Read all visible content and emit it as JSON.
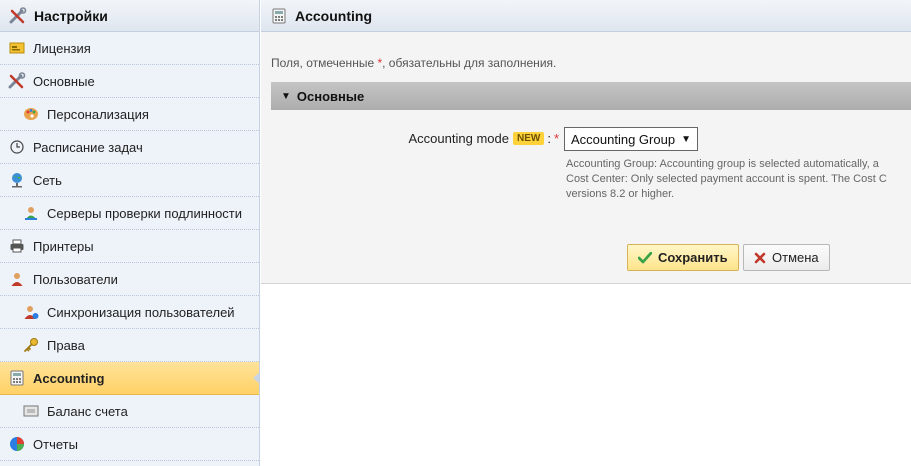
{
  "sidebar": {
    "title": "Настройки",
    "items": [
      {
        "label": "Лицензия",
        "icon": "license-icon",
        "level": 0
      },
      {
        "label": "Основные",
        "icon": "tools-icon",
        "level": 0
      },
      {
        "label": "Персонализация",
        "icon": "palette-icon",
        "level": 1
      },
      {
        "label": "Расписание задач",
        "icon": "clock-icon",
        "level": 0
      },
      {
        "label": "Сеть",
        "icon": "network-icon",
        "level": 0
      },
      {
        "label": "Серверы проверки подлинности",
        "icon": "auth-server-icon",
        "level": 1
      },
      {
        "label": "Принтеры",
        "icon": "printer-icon",
        "level": 0
      },
      {
        "label": "Пользователи",
        "icon": "user-icon",
        "level": 0
      },
      {
        "label": "Синхронизация пользователей",
        "icon": "user-sync-icon",
        "level": 1
      },
      {
        "label": "Права",
        "icon": "key-icon",
        "level": 1
      },
      {
        "label": "Accounting",
        "icon": "accounting-icon",
        "level": 0,
        "active": true
      },
      {
        "label": "Баланс счета",
        "icon": "balance-card-icon",
        "level": 1
      },
      {
        "label": "Отчеты",
        "icon": "pie-chart-icon",
        "level": 0
      }
    ]
  },
  "main": {
    "title": "Accounting",
    "required_note_prefix": "Поля, отмеченные ",
    "required_note_star": "*",
    "required_note_suffix": ", обязательны для заполнения.",
    "section_title": "Основные",
    "field": {
      "label": "Accounting mode",
      "badge": "NEW",
      "colon": ":",
      "required_star": "*",
      "value": "Accounting Group",
      "help_lines": [
        "Accounting Group: Accounting group is selected automatically, a",
        "Cost Center: Only selected payment account is spent. The Cost C",
        "versions 8.2 or higher."
      ]
    },
    "buttons": {
      "save": "Сохранить",
      "cancel": "Отмена"
    }
  },
  "colors": {
    "active_item": "#ffd166",
    "badge": "#ffd23a",
    "required": "#dd3333"
  }
}
